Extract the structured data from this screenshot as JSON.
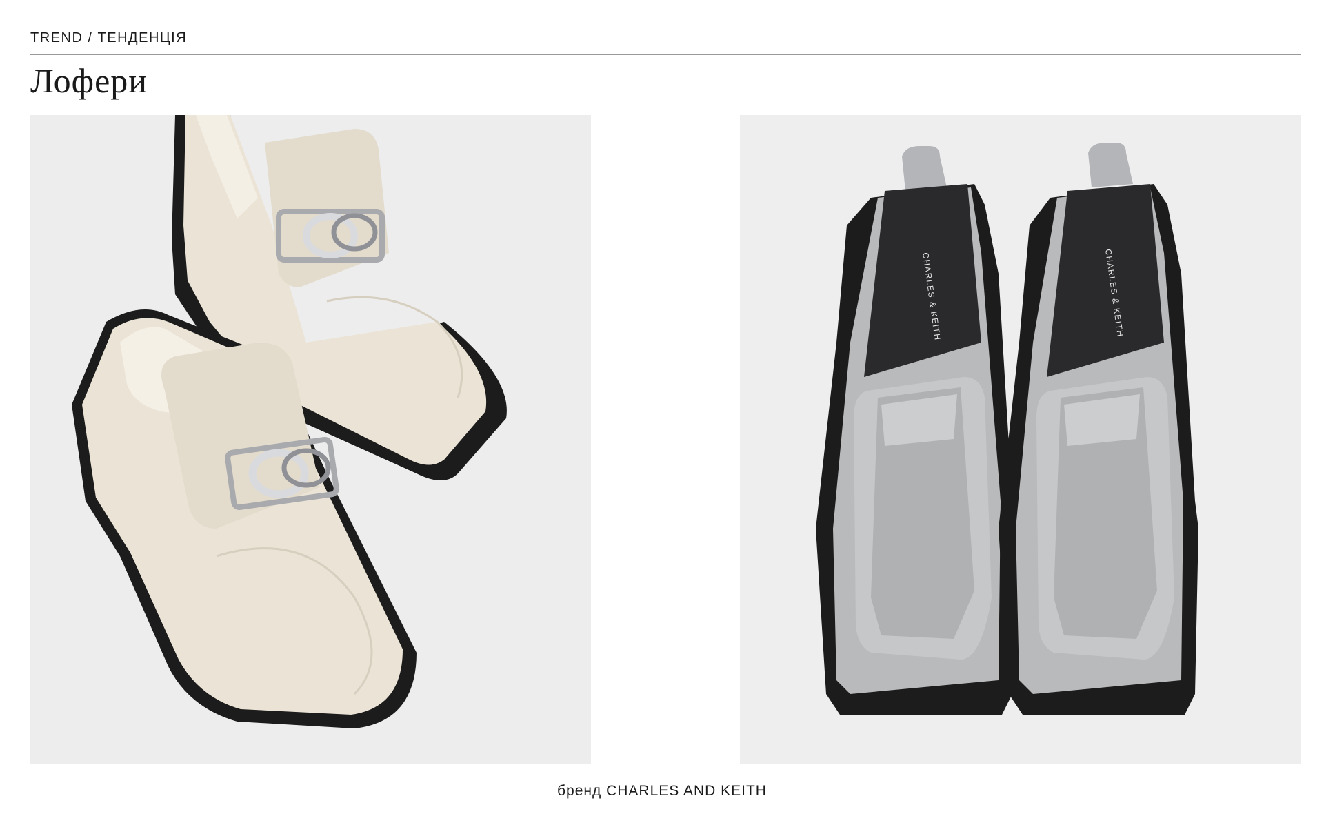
{
  "header": {
    "kicker": "TREND / ТЕНДЕНЦІЯ",
    "title": "Лофери"
  },
  "photos": {
    "left": {
      "subject": "cream leather loafers with silver chain hardware"
    },
    "right": {
      "subject": "grey patent square-toe loafers on black platform soles",
      "insole_label": "CHARLES & KEITH"
    }
  },
  "caption": "бренд CHARLES AND KEITH",
  "colors": {
    "background": "#ffffff",
    "text": "#1a1a1a",
    "rule": "#9a9a9a",
    "photo_left_bg": "#ededed",
    "photo_right_bg": "#eeeeef",
    "cream_leather": "#ebe4d6",
    "grey_patent": "#b9babc",
    "sole": "#1c1c1c"
  }
}
